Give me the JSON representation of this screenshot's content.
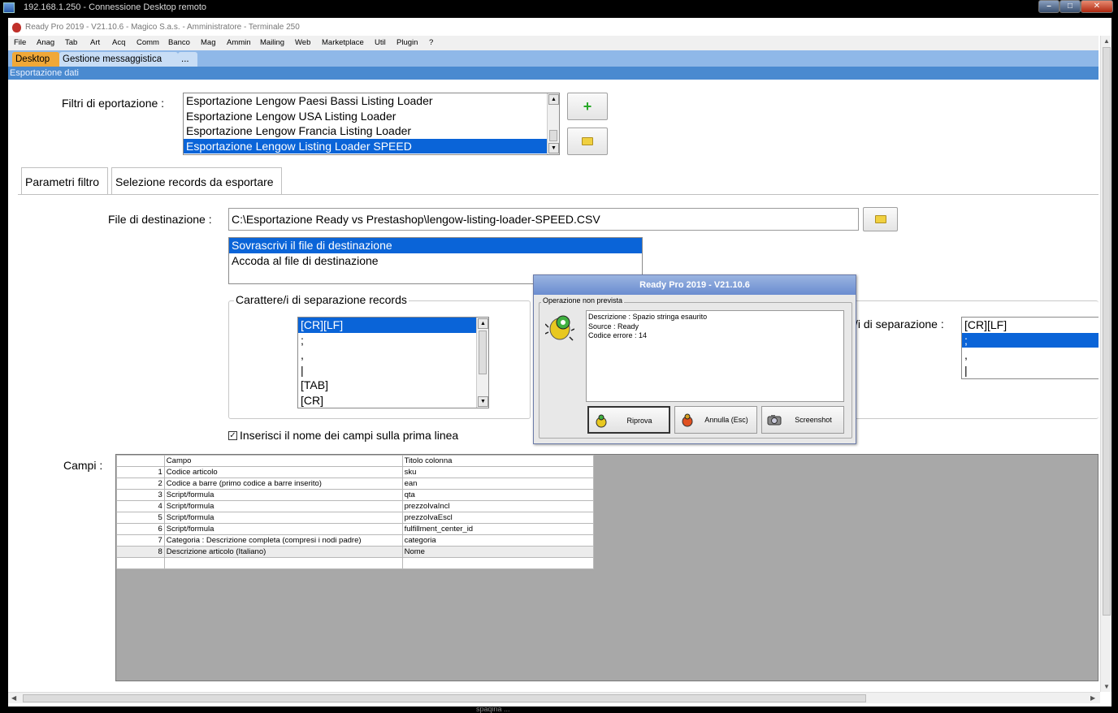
{
  "rdp": {
    "title": "192.168.1.250 - Connessione Desktop remoto"
  },
  "app": {
    "title": "Ready Pro 2019 - V21.10.6 - Magico S.a.s. - Amministratore - Terminale 250"
  },
  "menu": [
    "File",
    "Anag",
    "Tab",
    "Art",
    "Acq",
    "Comm",
    "Banco",
    "Mag",
    "Ammin",
    "Mailing",
    "Web",
    "Marketplace",
    "Util",
    "Plugin",
    "?"
  ],
  "tabs": {
    "desktop": "Desktop",
    "messaggistica": "Gestione messaggistica",
    "more": "..."
  },
  "section_title": "Esportazione dati",
  "filters": {
    "label": "Filtri di eportazione :",
    "items": [
      "Esportazione Lengow Paesi Bassi Listing Loader",
      "Esportazione Lengow USA Listing Loader",
      "Esportazione Lengow Francia Listing Loader",
      "Esportazione Lengow Listing Loader SPEED"
    ],
    "add_glyph": "+"
  },
  "subtabs": {
    "params": "Parametri filtro",
    "selection": "Selezione records da esportare"
  },
  "destination": {
    "label": "File di destinazione :",
    "value": "C:\\Esportazione Ready vs Prestashop\\lengow-listing-loader-SPEED.CSV",
    "modes": [
      "Sovrascrivi il file di destinazione",
      "Accoda al file di destinazione"
    ]
  },
  "separators": {
    "group_label": "Carattere/i di separazione records",
    "items": [
      "[CR][LF]",
      ";",
      ",",
      "|",
      "[TAB]",
      "[CR]"
    ],
    "field_label": "/i di separazione :",
    "field_items": [
      "[CR][LF]",
      ";",
      ",",
      "|"
    ]
  },
  "header_checkbox": {
    "label": "Inserisci il nome dei campi sulla prima linea",
    "check": "✓"
  },
  "campi": {
    "label": "Campi :",
    "headers": [
      "Campo",
      "Titolo colonna"
    ],
    "rows": [
      {
        "n": "1",
        "campo": "Codice articolo",
        "titolo": "sku"
      },
      {
        "n": "2",
        "campo": "Codice a barre (primo codice a barre inserito)",
        "titolo": "ean"
      },
      {
        "n": "3",
        "campo": "Script/formula",
        "titolo": "qta"
      },
      {
        "n": "4",
        "campo": "Script/formula",
        "titolo": "prezzoIvaIncl"
      },
      {
        "n": "5",
        "campo": "Script/formula",
        "titolo": "prezzoIvaEscl"
      },
      {
        "n": "6",
        "campo": "Script/formula",
        "titolo": "fulfillment_center_id"
      },
      {
        "n": "7",
        "campo": "Categoria : Descrizione completa (compresi i nodi padre)",
        "titolo": "categoria"
      },
      {
        "n": "8",
        "campo": "Descrizione articolo (Italiano)",
        "titolo": "Nome"
      }
    ]
  },
  "dialog": {
    "title": "Ready Pro 2019 - V21.10.6",
    "group_title": "Operazione non prevista",
    "lines": [
      "Descrizione : Spazio stringa esaurito",
      "Source : Ready",
      "Codice errore : 14"
    ],
    "buttons": {
      "retry": "Riprova",
      "cancel": "Annulla (Esc)",
      "screenshot": "Screenshot"
    }
  },
  "bottom_status": "spaqina ...",
  "colors": {
    "accent_tab": "#f0a838",
    "selection": "#0a64d8",
    "section_bar": "#4a8ad0"
  }
}
